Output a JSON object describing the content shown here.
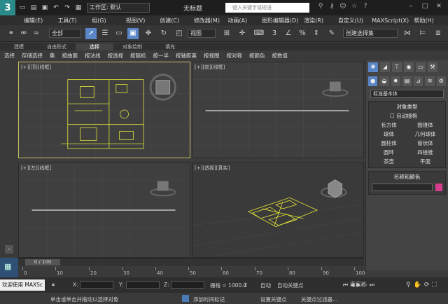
{
  "titlebar": {
    "logo": "3",
    "workspace": "工作区: 默认",
    "title": "无标题",
    "search_placeholder": "键入关键字或短语"
  },
  "menu": [
    "编辑(E)",
    "工具(T)",
    "组(G)",
    "视图(V)",
    "创建(C)",
    "修改器(M)",
    "动画(A)",
    "图形编辑器(D)",
    "渲染(R)",
    "自定义(U)",
    "MAXScript(X)",
    "帮助(H)"
  ],
  "toolbar": {
    "filter": "全部",
    "refcoord": "视图",
    "selset": "创建选择集"
  },
  "ribbon_tabs": [
    "建模",
    "自由形式",
    "选择",
    "对象绘制",
    "填充"
  ],
  "ribbon_active": "选择",
  "ribbon_items": [
    "选择",
    "存储选择",
    "集",
    "按曲面",
    "按法线",
    "按透视",
    "按随机",
    "按一半",
    "按轴距离",
    "按视图",
    "按对称",
    "按颜色",
    "按数值"
  ],
  "viewports": {
    "top": "[+][顶][线框]",
    "front": "[+][前][线框]",
    "left": "[+][左][线框]",
    "persp": "[+][透视][真实]"
  },
  "panel": {
    "dropdown": "标准基本体",
    "objtype_title": "对象类型",
    "autogrid": "自动栅格",
    "objects": [
      "长方体",
      "圆锥体",
      "球体",
      "几何球体",
      "圆柱体",
      "管状体",
      "圆环",
      "四棱锥",
      "茶壶",
      "平面"
    ],
    "namecolor_title": "名称和颜色"
  },
  "timeline": {
    "frame": "0 / 100",
    "ticks": [
      "0",
      "10",
      "20",
      "30",
      "40",
      "50",
      "60",
      "70",
      "80",
      "90",
      "100"
    ]
  },
  "status": {
    "welcome": "欢迎使用 MAXSc",
    "prompt": "单击或单击并拖动以选择对象",
    "x_label": "X:",
    "y_label": "Y:",
    "z_label": "Z:",
    "grid": "栅格 = 1000.0",
    "autokey": "自动",
    "setkey": "自动关键点",
    "setkey2": "设置关键点",
    "filters": "关键点过滤器...",
    "addtime": "添加时间标记",
    "selected": "选定对"
  },
  "colors": {
    "accent": "#5a86c8",
    "floorplan": "#e6e63a",
    "active_border": "#c9c163"
  }
}
